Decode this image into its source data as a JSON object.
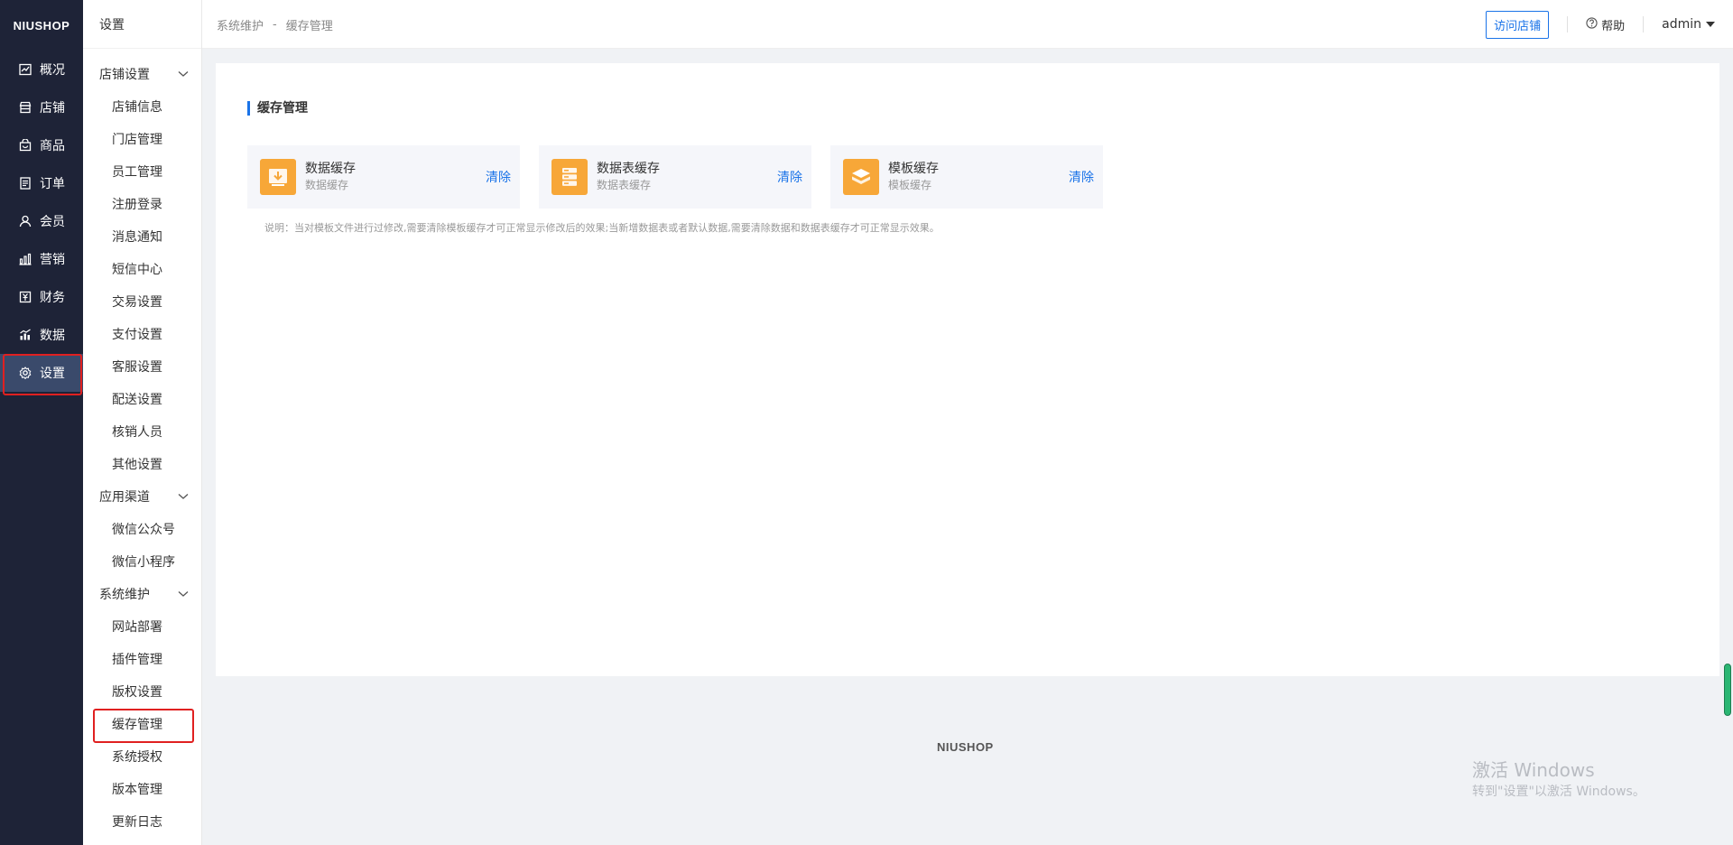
{
  "nav": {
    "logo": "NIUSHOP",
    "items": [
      {
        "label": "概况",
        "icon": "overview-icon"
      },
      {
        "label": "店铺",
        "icon": "store-icon"
      },
      {
        "label": "商品",
        "icon": "goods-icon"
      },
      {
        "label": "订单",
        "icon": "order-icon"
      },
      {
        "label": "会员",
        "icon": "member-icon"
      },
      {
        "label": "营销",
        "icon": "marketing-icon"
      },
      {
        "label": "财务",
        "icon": "finance-icon"
      },
      {
        "label": "数据",
        "icon": "data-icon"
      },
      {
        "label": "设置",
        "icon": "gear-icon"
      }
    ]
  },
  "side": {
    "title": "设置",
    "groups": [
      {
        "label": "店铺设置",
        "items": [
          "店铺信息",
          "门店管理",
          "员工管理",
          "注册登录",
          "消息通知",
          "短信中心",
          "交易设置",
          "支付设置",
          "客服设置",
          "配送设置",
          "核销人员",
          "其他设置"
        ]
      },
      {
        "label": "应用渠道",
        "items": [
          "微信公众号",
          "微信小程序"
        ]
      },
      {
        "label": "系统维护",
        "items": [
          "网站部署",
          "插件管理",
          "版权设置",
          "缓存管理",
          "系统授权",
          "版本管理",
          "更新日志"
        ]
      }
    ]
  },
  "header": {
    "crumb1": "系统维护",
    "sep": "-",
    "crumb2": "缓存管理",
    "visit": "访问店铺",
    "help": "帮助",
    "user": "admin"
  },
  "main": {
    "title": "缓存管理",
    "caches": [
      {
        "name": "数据缓存",
        "sub": "数据缓存",
        "action": "清除"
      },
      {
        "name": "数据表缓存",
        "sub": "数据表缓存",
        "action": "清除"
      },
      {
        "name": "模板缓存",
        "sub": "模板缓存",
        "action": "清除"
      }
    ],
    "note": "说明：当对模板文件进行过修改,需要清除模板缓存才可正常显示修改后的效果;当新增数据表或者默认数据,需要清除数据和数据表缓存才可正常显示效果。"
  },
  "footer": {
    "logo": "NIUSHOP"
  },
  "watermark": {
    "line1": "激活 Windows",
    "line2": "转到\"设置\"以激活 Windows。"
  },
  "colors": {
    "nav_bg": "#1e2337",
    "accent": "#1a73e8",
    "icon_bg": "#f7a738",
    "highlight": "#e02020"
  }
}
